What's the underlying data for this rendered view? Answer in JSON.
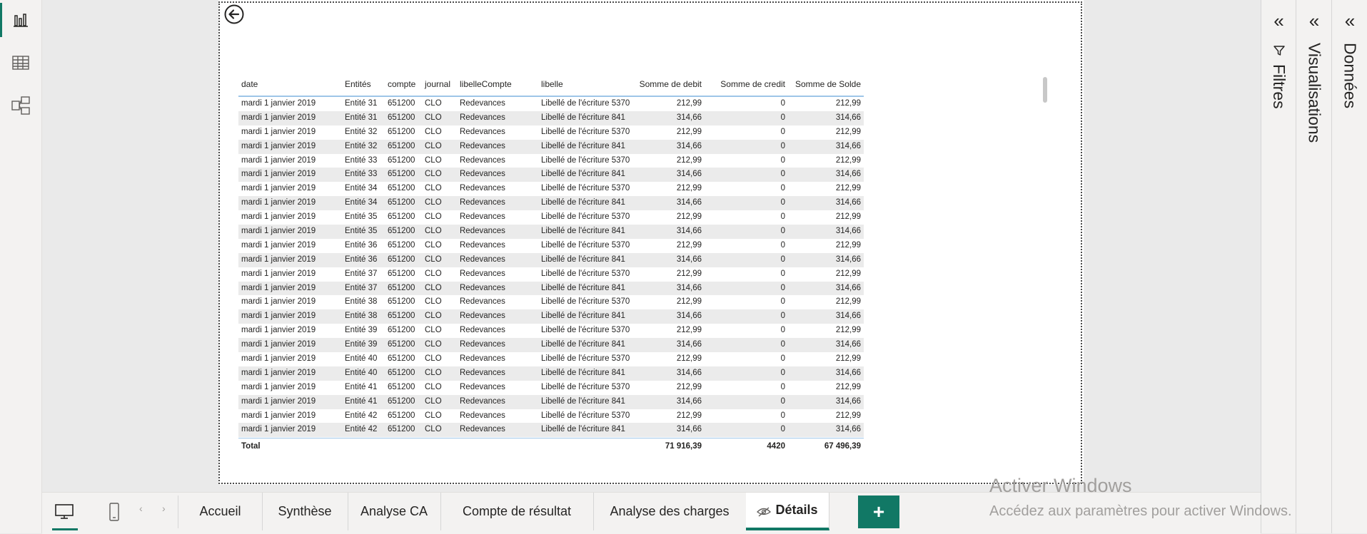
{
  "left_rail": {
    "items": [
      "report-view",
      "table-view",
      "model-view"
    ]
  },
  "table": {
    "headers": [
      "date",
      "Entités",
      "compte",
      "journal",
      "libelleCompte",
      "libelle",
      "Somme de debit",
      "Somme de credit",
      "Somme de Solde"
    ],
    "rows": [
      [
        "mardi 1 janvier 2019",
        "Entité 31",
        "651200",
        "CLO",
        "Redevances",
        "Libellé de l'écriture 5370",
        "212,99",
        "0",
        "212,99"
      ],
      [
        "mardi 1 janvier 2019",
        "Entité 31",
        "651200",
        "CLO",
        "Redevances",
        "Libellé de l'écriture 841",
        "314,66",
        "0",
        "314,66"
      ],
      [
        "mardi 1 janvier 2019",
        "Entité 32",
        "651200",
        "CLO",
        "Redevances",
        "Libellé de l'écriture 5370",
        "212,99",
        "0",
        "212,99"
      ],
      [
        "mardi 1 janvier 2019",
        "Entité 32",
        "651200",
        "CLO",
        "Redevances",
        "Libellé de l'écriture 841",
        "314,66",
        "0",
        "314,66"
      ],
      [
        "mardi 1 janvier 2019",
        "Entité 33",
        "651200",
        "CLO",
        "Redevances",
        "Libellé de l'écriture 5370",
        "212,99",
        "0",
        "212,99"
      ],
      [
        "mardi 1 janvier 2019",
        "Entité 33",
        "651200",
        "CLO",
        "Redevances",
        "Libellé de l'écriture 841",
        "314,66",
        "0",
        "314,66"
      ],
      [
        "mardi 1 janvier 2019",
        "Entité 34",
        "651200",
        "CLO",
        "Redevances",
        "Libellé de l'écriture 5370",
        "212,99",
        "0",
        "212,99"
      ],
      [
        "mardi 1 janvier 2019",
        "Entité 34",
        "651200",
        "CLO",
        "Redevances",
        "Libellé de l'écriture 841",
        "314,66",
        "0",
        "314,66"
      ],
      [
        "mardi 1 janvier 2019",
        "Entité 35",
        "651200",
        "CLO",
        "Redevances",
        "Libellé de l'écriture 5370",
        "212,99",
        "0",
        "212,99"
      ],
      [
        "mardi 1 janvier 2019",
        "Entité 35",
        "651200",
        "CLO",
        "Redevances",
        "Libellé de l'écriture 841",
        "314,66",
        "0",
        "314,66"
      ],
      [
        "mardi 1 janvier 2019",
        "Entité 36",
        "651200",
        "CLO",
        "Redevances",
        "Libellé de l'écriture 5370",
        "212,99",
        "0",
        "212,99"
      ],
      [
        "mardi 1 janvier 2019",
        "Entité 36",
        "651200",
        "CLO",
        "Redevances",
        "Libellé de l'écriture 841",
        "314,66",
        "0",
        "314,66"
      ],
      [
        "mardi 1 janvier 2019",
        "Entité 37",
        "651200",
        "CLO",
        "Redevances",
        "Libellé de l'écriture 5370",
        "212,99",
        "0",
        "212,99"
      ],
      [
        "mardi 1 janvier 2019",
        "Entité 37",
        "651200",
        "CLO",
        "Redevances",
        "Libellé de l'écriture 841",
        "314,66",
        "0",
        "314,66"
      ],
      [
        "mardi 1 janvier 2019",
        "Entité 38",
        "651200",
        "CLO",
        "Redevances",
        "Libellé de l'écriture 5370",
        "212,99",
        "0",
        "212,99"
      ],
      [
        "mardi 1 janvier 2019",
        "Entité 38",
        "651200",
        "CLO",
        "Redevances",
        "Libellé de l'écriture 841",
        "314,66",
        "0",
        "314,66"
      ],
      [
        "mardi 1 janvier 2019",
        "Entité 39",
        "651200",
        "CLO",
        "Redevances",
        "Libellé de l'écriture 5370",
        "212,99",
        "0",
        "212,99"
      ],
      [
        "mardi 1 janvier 2019",
        "Entité 39",
        "651200",
        "CLO",
        "Redevances",
        "Libellé de l'écriture 841",
        "314,66",
        "0",
        "314,66"
      ],
      [
        "mardi 1 janvier 2019",
        "Entité 40",
        "651200",
        "CLO",
        "Redevances",
        "Libellé de l'écriture 5370",
        "212,99",
        "0",
        "212,99"
      ],
      [
        "mardi 1 janvier 2019",
        "Entité 40",
        "651200",
        "CLO",
        "Redevances",
        "Libellé de l'écriture 841",
        "314,66",
        "0",
        "314,66"
      ],
      [
        "mardi 1 janvier 2019",
        "Entité 41",
        "651200",
        "CLO",
        "Redevances",
        "Libellé de l'écriture 5370",
        "212,99",
        "0",
        "212,99"
      ],
      [
        "mardi 1 janvier 2019",
        "Entité 41",
        "651200",
        "CLO",
        "Redevances",
        "Libellé de l'écriture 841",
        "314,66",
        "0",
        "314,66"
      ],
      [
        "mardi 1 janvier 2019",
        "Entité 42",
        "651200",
        "CLO",
        "Redevances",
        "Libellé de l'écriture 5370",
        "212,99",
        "0",
        "212,99"
      ],
      [
        "mardi 1 janvier 2019",
        "Entité 42",
        "651200",
        "CLO",
        "Redevances",
        "Libellé de l'écriture 841",
        "314,66",
        "0",
        "314,66"
      ]
    ],
    "total": {
      "label": "Total",
      "debit": "71 916,39",
      "credit": "4420",
      "solde": "67 496,39"
    }
  },
  "panels": {
    "filters": "Filtres",
    "visualizations": "Visualisations",
    "data": "Données"
  },
  "tabs": [
    "Accueil",
    "Synthèse",
    "Analyse CA",
    "Compte de résultat",
    "Analyse des charges",
    "Détails"
  ],
  "active_tab": "Détails",
  "add_page": "+",
  "watermark": {
    "title": "Activer Windows",
    "subtitle": "Accédez aux paramètres pour activer Windows."
  },
  "colors": {
    "accent": "#117865",
    "row_band": "#ebebeb",
    "header_rule": "#9ec5e8"
  }
}
